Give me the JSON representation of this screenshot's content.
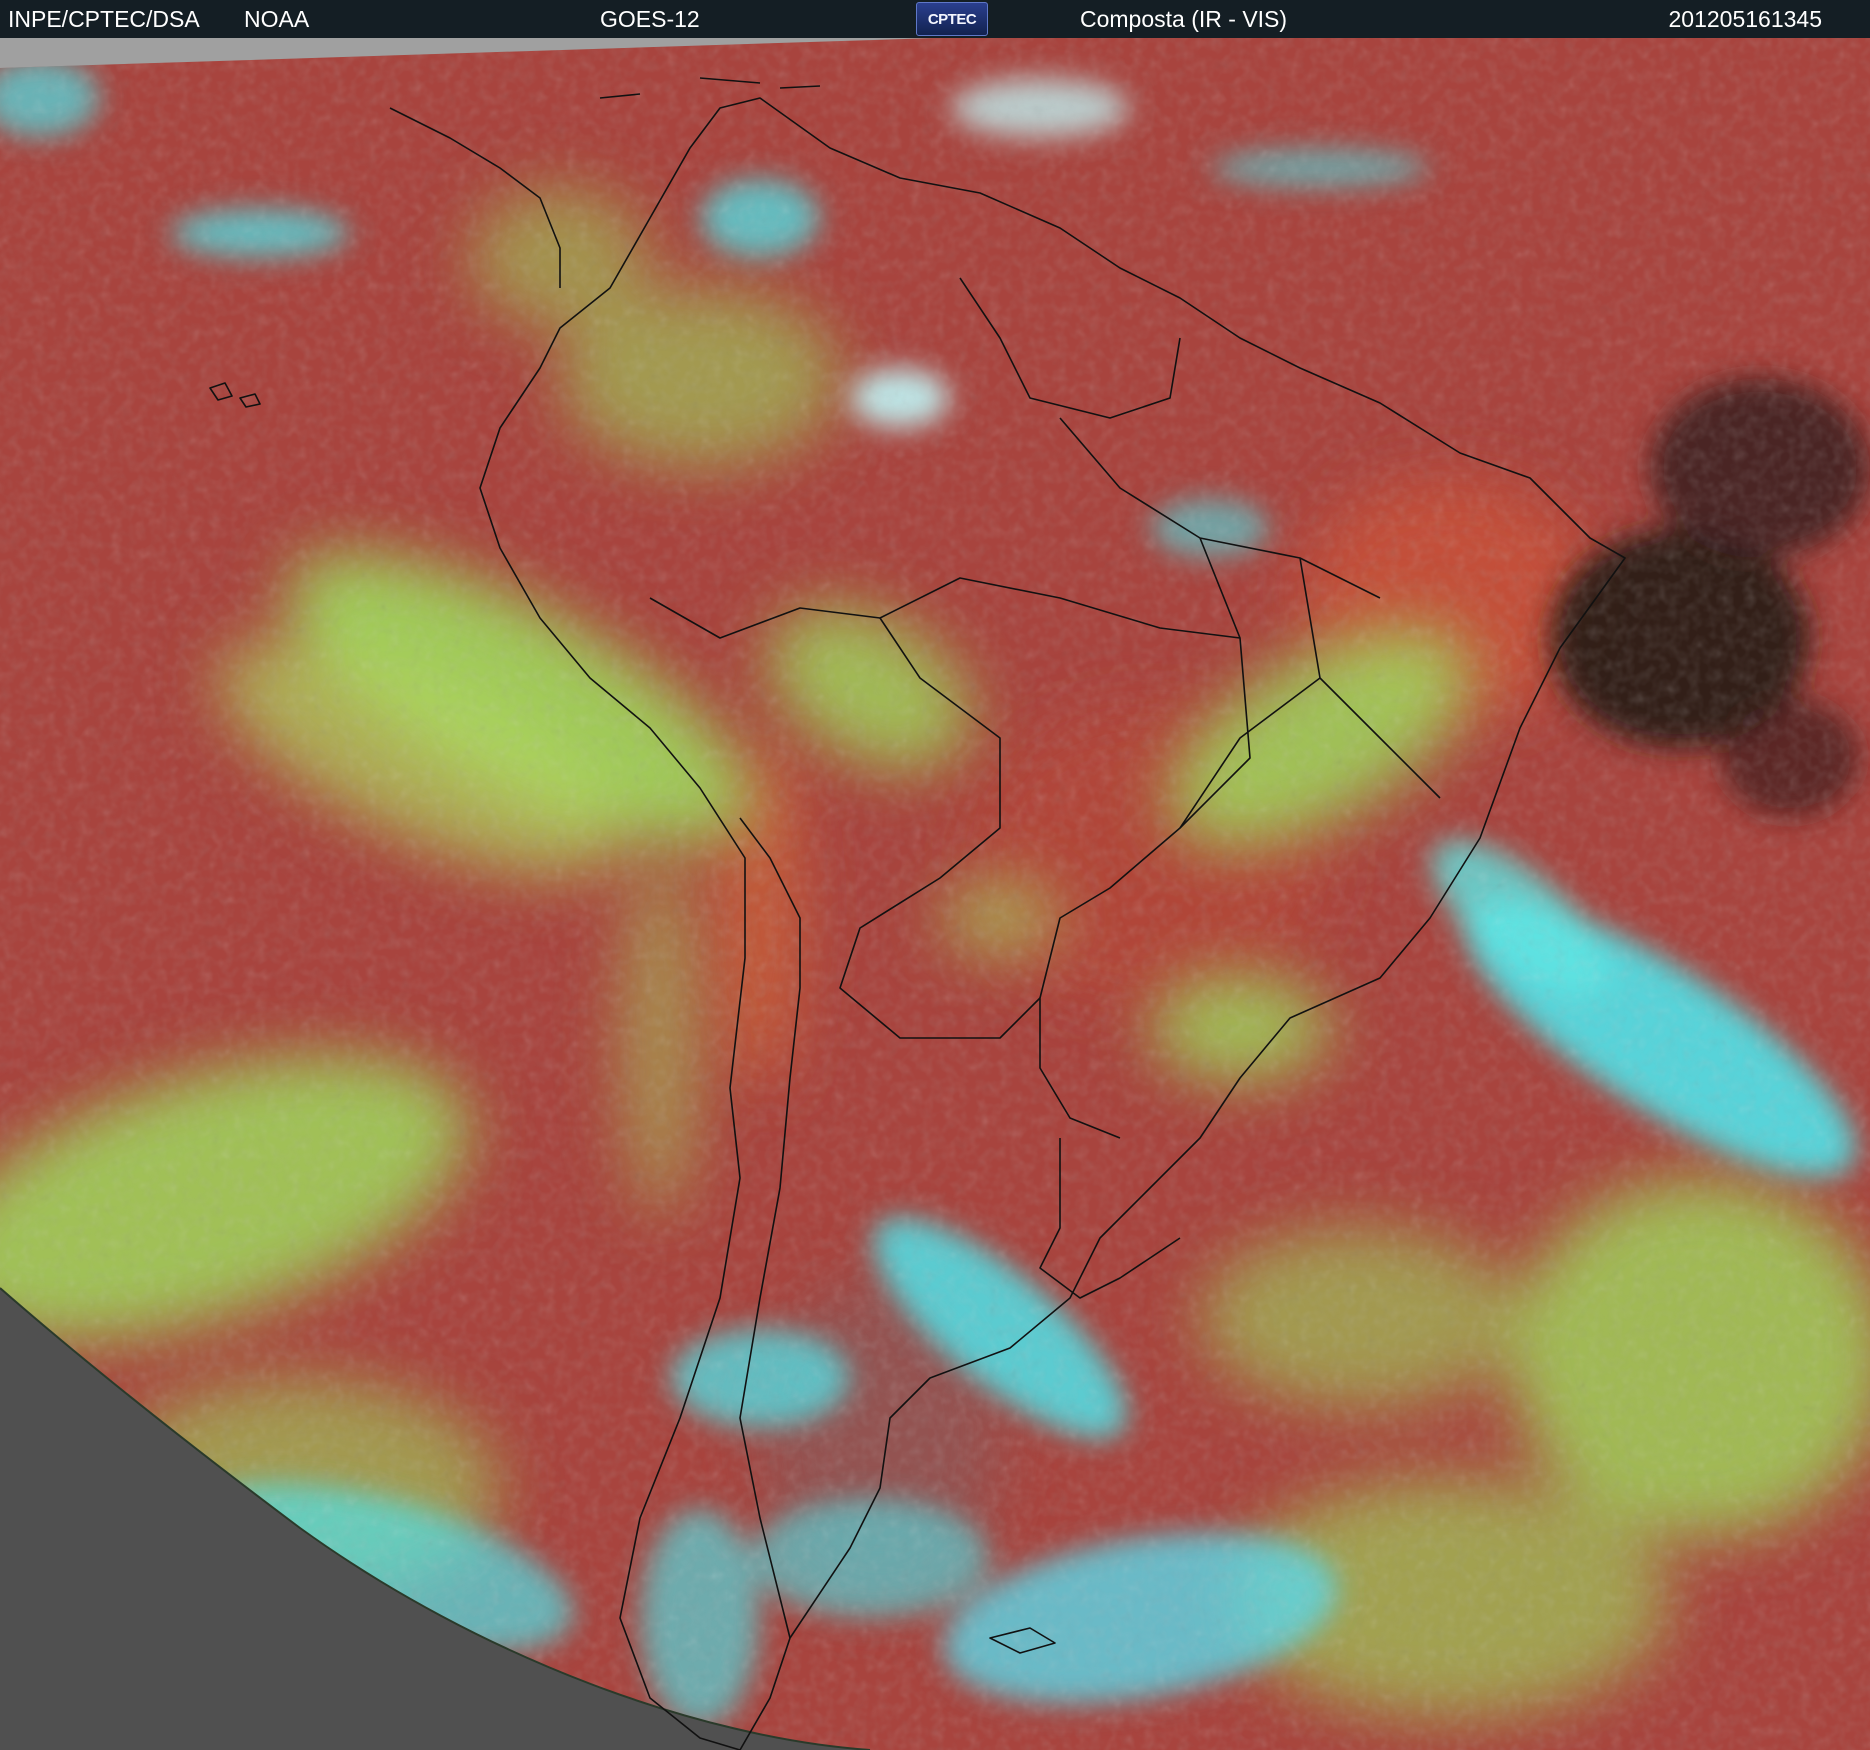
{
  "header": {
    "agency": "INPE/CPTEC/DSA",
    "source": "NOAA",
    "satellite": "GOES-12",
    "logo_text": "CPTEC",
    "product": "Composta (IR - VIS)",
    "timestamp": "201205161345"
  },
  "image": {
    "icons": [
      "cptec-logo-icon"
    ],
    "colors": {
      "header_bg": "#141e24",
      "clear_surface": "#a8443e",
      "warm_surface": "#c8523a",
      "low_cloud": "#9fe05e",
      "high_cloud": "#4fe3ea",
      "outside_disk": "#505050",
      "no_data": "#a0a0a0",
      "coastline": "#000000"
    }
  }
}
